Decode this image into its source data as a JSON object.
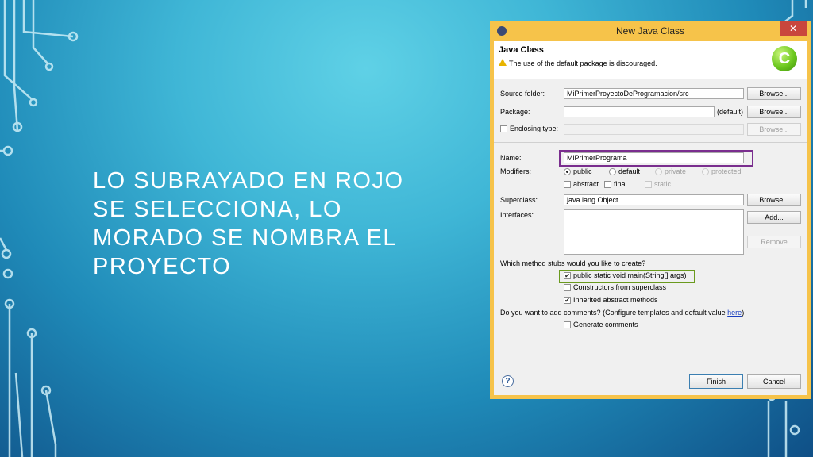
{
  "slide": {
    "title": "LO SUBRAYADO EN ROJO SE SELECCIONA, LO MORADO SE NOMBRA EL PROYECTO"
  },
  "dialog": {
    "window_title": "New Java Class",
    "close_glyph": "✕",
    "header_title": "Java Class",
    "warning": "The use of the default package is discouraged.",
    "logo_letter": "C",
    "source_folder": {
      "label": "Source folder:",
      "value": "MiPrimerProyectoDeProgramacion/src",
      "button": "Browse..."
    },
    "package": {
      "label": "Package:",
      "value": "",
      "hint": "(default)",
      "button": "Browse..."
    },
    "enclosing_type": {
      "label": "Enclosing type:",
      "value": "",
      "button": "Browse..."
    },
    "name": {
      "label": "Name:",
      "value": "MiPrimerPrograma"
    },
    "modifiers": {
      "label": "Modifiers:",
      "public": "public",
      "default": "default",
      "private": "private",
      "protected": "protected",
      "abstract": "abstract",
      "final": "final",
      "static": "static"
    },
    "superclass": {
      "label": "Superclass:",
      "value": "java.lang.Object",
      "button": "Browse..."
    },
    "interfaces": {
      "label": "Interfaces:",
      "add_button": "Add...",
      "remove_button": "Remove"
    },
    "stubs": {
      "question": "Which method stubs would you like to create?",
      "main": "public static void main(String[] args)",
      "constructors": "Constructors from superclass",
      "inherited": "Inherited abstract methods",
      "check_glyph": "✔"
    },
    "comments": {
      "question": "Do you want to add comments? (Configure templates and default value ",
      "link": "here",
      "question_end": ")",
      "generate": "Generate comments"
    },
    "footer": {
      "help": "?",
      "finish": "Finish",
      "cancel": "Cancel"
    }
  }
}
